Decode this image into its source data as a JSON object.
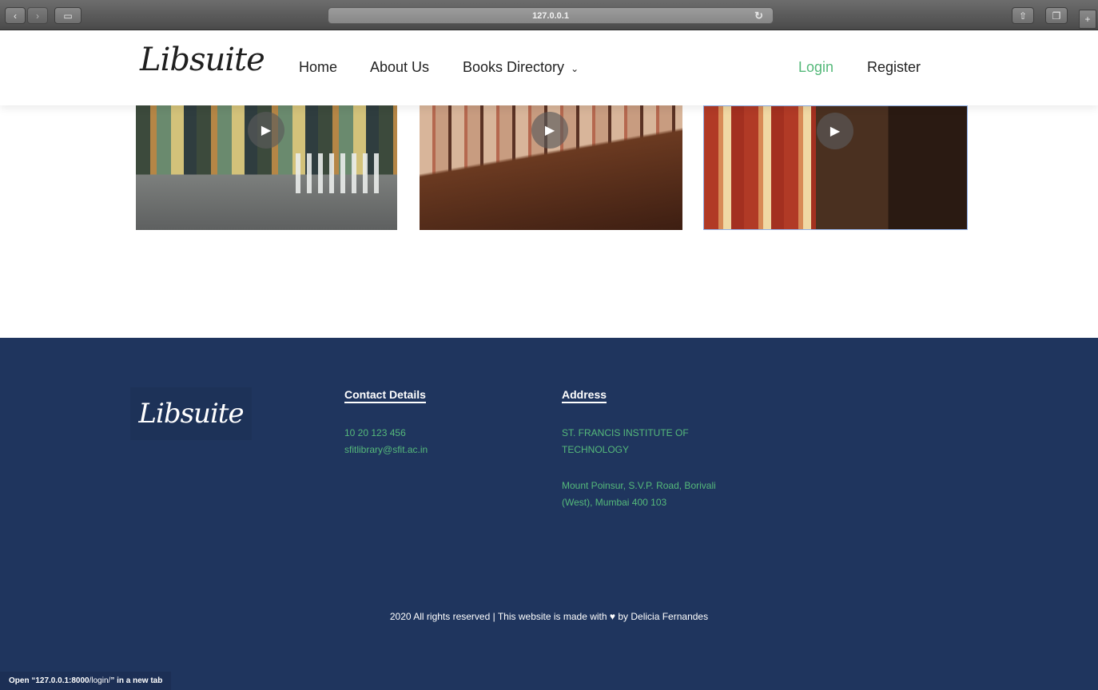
{
  "browser": {
    "address": "127.0.0.1",
    "status_prefix": "Open “127.0.0.1:8000",
    "status_path": "/login/",
    "status_suffix": "” in a new tab"
  },
  "header": {
    "logo": "Libsuite",
    "nav": {
      "home": "Home",
      "about": "About Us",
      "books": "Books Directory",
      "login": "Login",
      "register": "Register"
    }
  },
  "gallery": {
    "play_glyph": "▶"
  },
  "footer": {
    "logo": "Libsuite",
    "contact": {
      "heading": "Contact Details",
      "phone": "10 20 123 456",
      "email": "sfitlibrary@sfit.ac.in"
    },
    "address": {
      "heading": "Address",
      "line1": "ST. FRANCIS INSTITUTE OF",
      "line2": "TECHNOLOGY",
      "line3": "Mount Poinsur, S.V.P. Road, Borivali",
      "line4": "(West), Mumbai 400 103"
    },
    "copyright_pre": "2020 All rights reserved | This website is made with",
    "copyright_post": "by Delicia Fernandes"
  },
  "colors": {
    "accent": "#55b97a",
    "footer_bg": "#1f355e"
  }
}
